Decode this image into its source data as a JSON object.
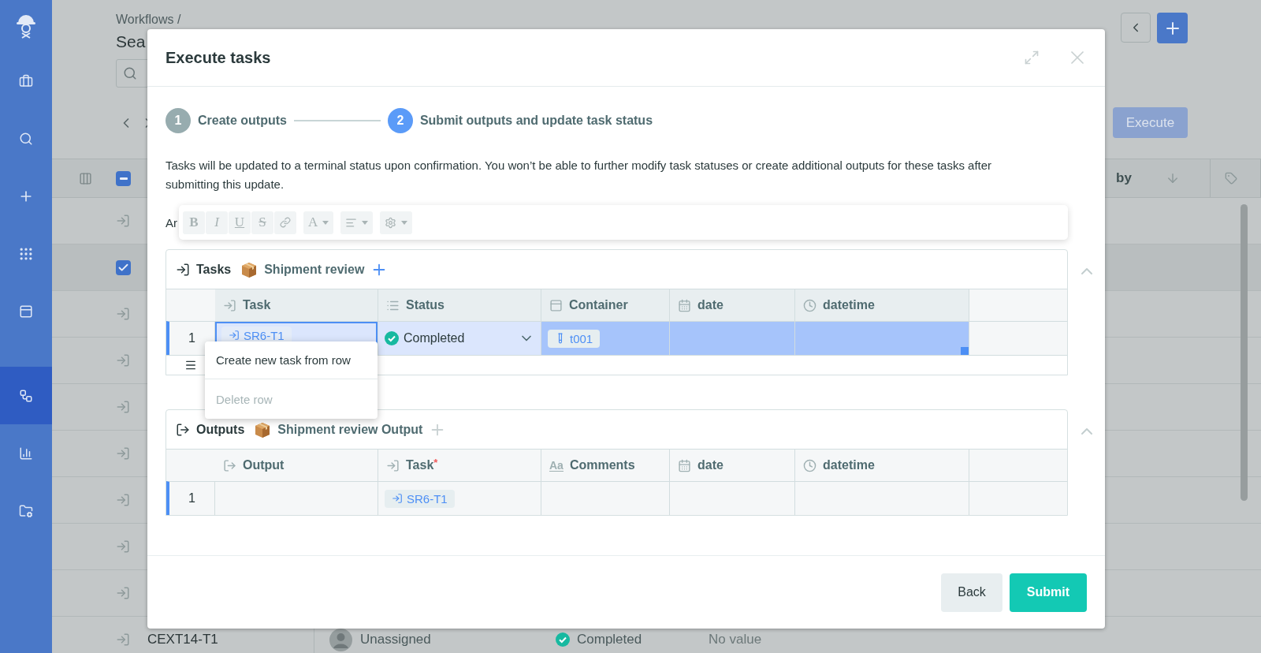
{
  "sidebar": {
    "groups": [
      [
        {
          "kind": "briefcase",
          "selected": false
        },
        {
          "kind": "search",
          "selected": false
        },
        {
          "kind": "plus",
          "selected": false
        },
        {
          "kind": "grid",
          "selected": false
        },
        {
          "kind": "container",
          "selected": false
        }
      ],
      [
        {
          "kind": "workflow",
          "selected": true
        },
        {
          "kind": "chart",
          "selected": false
        },
        {
          "kind": "folder",
          "selected": false
        }
      ]
    ]
  },
  "page": {
    "breadcrumb": "Workflows /",
    "title": "Sea",
    "execute_button": "Execute",
    "table": {
      "select_all_indeterminate": true,
      "header_label": "by",
      "rows": [
        {
          "checked": false
        },
        {
          "checked": true
        },
        {
          "checked": false
        },
        {
          "checked": false
        },
        {
          "checked": false
        },
        {
          "checked": false
        },
        {
          "checked": false
        },
        {
          "checked": false
        },
        {
          "checked": false
        },
        {
          "checked": false,
          "task": "CEXT14-T1",
          "assignee": "Unassigned",
          "status": "Completed",
          "value": "No value"
        }
      ]
    }
  },
  "modal": {
    "title": "Execute tasks",
    "steps": [
      {
        "number": "1",
        "label": "Create outputs",
        "selected": false
      },
      {
        "number": "2",
        "label": "Submit outputs and update task status",
        "selected": true
      }
    ],
    "notice": "Tasks will be updated to a terminal status upon confirmation. You won’t be able to further modify task statuses or create additional outputs for these tasks after submitting this update.",
    "field_label": "Ar",
    "toolbar": {
      "groups": [
        [
          {
            "kind": "bold",
            "text": "B"
          },
          {
            "kind": "italic",
            "text": "I"
          },
          {
            "kind": "underline",
            "text": "U"
          },
          {
            "kind": "strike",
            "text": "S"
          },
          {
            "kind": "link"
          }
        ],
        [
          {
            "kind": "color",
            "text": "A"
          }
        ],
        [
          {
            "kind": "align"
          }
        ],
        [
          {
            "kind": "settings"
          }
        ]
      ]
    },
    "sections": [
      {
        "kind": "tasks",
        "label": "Tasks",
        "schema": "Shipment review",
        "add_disabled": false,
        "columns": [
          {
            "label": "Task",
            "highlighted": true
          },
          {
            "label": "Status",
            "highlighted": true
          },
          {
            "label": "Container",
            "highlighted": true
          },
          {
            "label": "date",
            "highlighted": true
          },
          {
            "label": "datetime",
            "highlighted": true
          }
        ],
        "rows": [
          {
            "number": "1",
            "active": true,
            "cells": [
              {
                "kind": "task_chip",
                "text": "SR6-T1",
                "selected": true,
                "focused": true,
                "highlighted": false
              },
              {
                "kind": "status",
                "text": "Completed",
                "selected": true,
                "focused": false,
                "highlighted": false
              },
              {
                "kind": "container_chip",
                "text": "t001",
                "focused": false,
                "highlighted": true
              },
              {
                "kind": "empty",
                "focused": false,
                "highlighted": true
              },
              {
                "kind": "empty",
                "focused": false,
                "highlighted": true,
                "handle": true
              }
            ]
          }
        ]
      },
      {
        "kind": "outputs",
        "label": "Outputs",
        "schema": "Shipment review Output",
        "add_disabled": true,
        "columns": [
          {
            "label": "Output",
            "highlighted": false
          },
          {
            "label": "Task",
            "required_mark": "*",
            "highlighted": false
          },
          {
            "label": "Comments",
            "icon_text": "Aa",
            "highlighted": false
          },
          {
            "label": "date",
            "highlighted": false
          },
          {
            "label": "datetime",
            "highlighted": false
          }
        ],
        "rows": [
          {
            "number": "1",
            "active": true,
            "cells": [
              {
                "kind": "empty",
                "selected": false,
                "focused": false,
                "highlighted": false
              },
              {
                "kind": "task_chip",
                "text": "SR6-T1",
                "selected": false,
                "focused": false,
                "highlighted": false
              },
              {
                "kind": "empty",
                "selected": false,
                "focused": false,
                "highlighted": false
              },
              {
                "kind": "empty",
                "selected": false,
                "focused": false,
                "highlighted": false
              },
              {
                "kind": "empty",
                "selected": false,
                "focused": false,
                "highlighted": false
              }
            ]
          }
        ]
      }
    ],
    "context_menu": {
      "items": [
        {
          "label": "Create new task from row",
          "disabled": false
        },
        {
          "label": "Delete row",
          "disabled": true
        }
      ]
    },
    "buttons": [
      {
        "label": "Back",
        "kind": "secondary"
      },
      {
        "label": "Submit",
        "kind": "primary"
      }
    ]
  }
}
